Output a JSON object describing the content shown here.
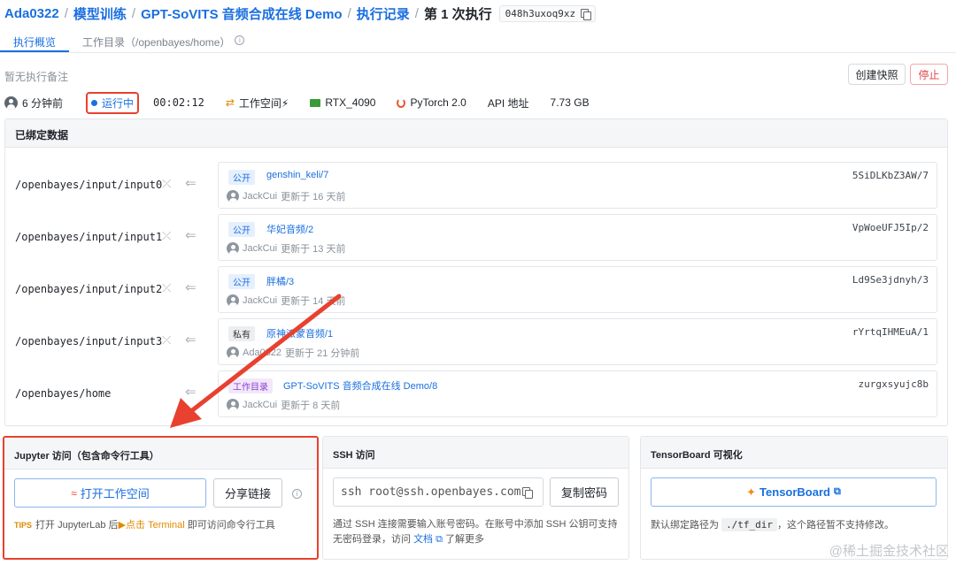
{
  "breadcrumb": {
    "user": "Ada0322",
    "section": "模型训练",
    "project": "GPT-SoVITS 音频合成在线 Demo",
    "records": "执行记录",
    "current": "第 1 次执行",
    "run_id": "048h3uxoq9xz",
    "sep": "/"
  },
  "tabs": [
    {
      "label": "执行概览"
    },
    {
      "label": "工作目录（/openbayes/home）"
    }
  ],
  "note": "暂无执行备注",
  "actions": {
    "snapshot": "创建快照",
    "stop": "停止"
  },
  "status": {
    "time_ago": "6 分钟前",
    "state": "运行中",
    "duration": "00:02:12",
    "workspace": "工作空间⚡",
    "gpu": "RTX_4090",
    "framework": "PyTorch 2.0",
    "api": "API 地址",
    "size": "7.73 GB"
  },
  "bound_data": {
    "title": "已绑定数据",
    "mounts": [
      {
        "path": "/openbayes/input/input0",
        "badge": "公开",
        "badge_type": "pub",
        "name": "genshin_keli/7",
        "hash": "5SiDLKbZ3AW/7",
        "owner": "JackCui",
        "updated": "更新于 16 天前"
      },
      {
        "path": "/openbayes/input/input1",
        "badge": "公开",
        "badge_type": "pub",
        "name": "华妃音频/2",
        "hash": "VpWoeUFJ5Ip/2",
        "owner": "JackCui",
        "updated": "更新于 13 天前"
      },
      {
        "path": "/openbayes/input/input2",
        "badge": "公开",
        "badge_type": "pub",
        "name": "胖橘/3",
        "hash": "Ld9Se3jdnyh/3",
        "owner": "JackCui",
        "updated": "更新于 14 天前"
      },
      {
        "path": "/openbayes/input/input3",
        "badge": "私有",
        "badge_type": "priv",
        "name": "原神派蒙音频/1",
        "hash": "rYrtqIHMEuA/1",
        "owner": "Ada0322",
        "updated": "更新于 21 分钟前"
      },
      {
        "path": "/openbayes/home",
        "badge": "工作目录",
        "badge_type": "ws",
        "name": "GPT-SoVITS 音频合成在线 Demo/8",
        "hash": "zurgxsyujc8b",
        "owner": "JackCui",
        "updated": "更新于 8 天前"
      }
    ]
  },
  "jupyter": {
    "title": "Jupyter 访问（包含命令行工具）",
    "open_button": "打开工作空间",
    "share_button": "分享链接",
    "tips_tag": "TIPS",
    "tips_pre": "打开 JupyterLab 后",
    "tips_highlight": "点击 Terminal",
    "tips_post": "即可访问命令行工具"
  },
  "ssh": {
    "title": "SSH 访问",
    "command": "ssh root@ssh.openbayes.com",
    "copy_password": "复制密码",
    "desc_pre": "通过 SSH 连接需要输入账号密码。在账号中添加 SSH 公钥可支持无密码登录，访问",
    "doc_link": "文档",
    "desc_post": "了解更多"
  },
  "tensorboard": {
    "title": "TensorBoard 可视化",
    "button": "TensorBoard",
    "desc_pre": "默认绑定路径为",
    "path": "./tf_dir",
    "desc_post": "，这个路径暂不支持修改。"
  },
  "watermark": "@稀土掘金技术社区",
  "colors": {
    "accent": "#1a6fe0",
    "annotation": "#e8412f",
    "stop": "#e0454b"
  }
}
